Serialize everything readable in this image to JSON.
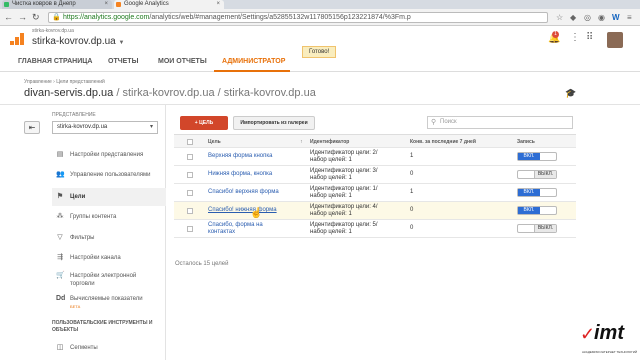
{
  "browser": {
    "tabs": [
      {
        "label": "Чистка ковров в Днепр",
        "active": false
      },
      {
        "label": "Google Analytics",
        "active": true
      }
    ],
    "url_host": "https://analytics.google.com",
    "url_path": "/analytics/web/#management/Settings/a52855132w117805156p123221874/%3Fm.p"
  },
  "header": {
    "account_small": "stirka-kovrov.dp.ua",
    "account_big": "stirka-kovrov.dp.ua",
    "notification_count": "1",
    "ready_label": "Готово!"
  },
  "nav": {
    "items": [
      "ГЛАВНАЯ СТРАНИЦА",
      "ОТЧЕТЫ",
      "МОИ ОТЧЕТЫ",
      "АДМИНИСТРАТОР"
    ]
  },
  "breadcrumb": "Управление › Цели представлений",
  "page_title": {
    "main": "divan-servis.dp.ua",
    "sub": " / stirka-kovrov.dp.ua / stirka-kovrov.dp.ua"
  },
  "sidebar": {
    "view_label": "ПРЕДСТАВЛЕНИЕ",
    "view_selected": "stirka-kovrov.dp.ua",
    "items": [
      {
        "label": "Настройки представления",
        "icon": "document-icon"
      },
      {
        "label": "Управление пользователями",
        "icon": "users-icon"
      },
      {
        "label": "Цели",
        "icon": "flag-icon",
        "active": true
      },
      {
        "label": "Группы контента",
        "icon": "content-groups-icon"
      },
      {
        "label": "Фильтры",
        "icon": "filter-icon"
      },
      {
        "label": "Настройки канала",
        "icon": "channel-icon"
      },
      {
        "label": "Настройки электронной торговли",
        "icon": "cart-icon"
      },
      {
        "label": "Вычисляемые показатели",
        "icon": "calculated-icon",
        "badge": "БЕТА"
      }
    ],
    "section_header": "ПОЛЬЗОВАТЕЛЬСКИЕ ИНСТРУМЕНТЫ И ОБЪЕКТЫ",
    "segments_label": "Сегменты"
  },
  "toolbar": {
    "new_goal": "+ ЦЕЛЬ",
    "import_gallery": "Импортировать из галереи",
    "search_placeholder": "Поиск"
  },
  "table": {
    "headers": [
      "Цель",
      "Идентификатор",
      "Конв. за последние 7 дней",
      "Запись"
    ],
    "rows": [
      {
        "goal": "Верхняя форма кнопка",
        "id_line1": "Идентификатор цели: 2/",
        "id_line2": "набор целей: 1",
        "conv": "1",
        "on": true
      },
      {
        "goal": "Нижняя форма, кнопка",
        "id_line1": "Идентификатор цели: 3/",
        "id_line2": "набор целей: 1",
        "conv": "0",
        "on": false
      },
      {
        "goal": "Спасибо! верхняя форма",
        "id_line1": "Идентификатор цели: 1/",
        "id_line2": "набор целей: 1",
        "conv": "1",
        "on": true
      },
      {
        "goal": "Спасибо! нижняя форма",
        "id_line1": "Идентификатор цели: 4/",
        "id_line2": "набор целей: 1",
        "conv": "0",
        "on": true
      },
      {
        "goal_line1": "Спасибо, форма на",
        "goal_line2": "контактах",
        "id_line1": "Идентификатор цели: 5/",
        "id_line2": "набор целей: 1",
        "conv": "0",
        "on": false
      }
    ],
    "toggle_on": "ВКЛ.",
    "toggle_off": "ВЫКЛ."
  },
  "remaining": "Осталось 15 целей",
  "watermark": {
    "letters": "imt",
    "tagline": "АКАДЕМИЯ ИНТЕРНЕТ ТЕХНОЛОГИЙ"
  }
}
